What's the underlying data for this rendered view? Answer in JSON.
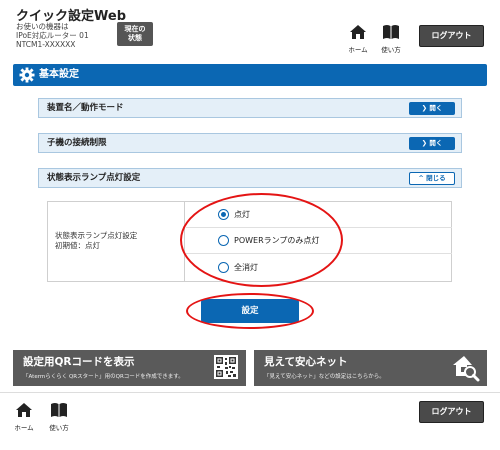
{
  "header": {
    "title": "クイック設定Web",
    "device_line1": "お使いの機器は",
    "device_line2": "IPoE対応ルーター 01",
    "device_line3": "NTCM1-XXXXXX",
    "status_button_line1": "現在の",
    "status_button_line2": "状態",
    "home_label": "ホーム",
    "help_label": "使い方",
    "logout_label": "ログアウト"
  },
  "section": {
    "title": "基本設定",
    "icon": "gear-icon"
  },
  "accordions": [
    {
      "label": "装置名／動作モード",
      "button": "開く",
      "state": "closed"
    },
    {
      "label": "子機の接続制限",
      "button": "開く",
      "state": "closed"
    },
    {
      "label": "状態表示ランプ点灯設定",
      "button": "閉じる",
      "state": "open"
    }
  ],
  "lamp_setting": {
    "label_line1": "状態表示ランプ点灯設定",
    "label_line2": "初期値：点灯",
    "options": [
      "点灯",
      "POWERランプのみ点灯",
      "全消灯"
    ],
    "selected": "点灯"
  },
  "apply_label": "設定",
  "banners": {
    "qr": {
      "title": "設定用QRコードを表示",
      "desc": "「Atermらくらく QRスタート」用のQRコードを作成できます。"
    },
    "safe": {
      "title": "見えて安心ネット",
      "desc": "「見えて安心ネット」などの設定はこちらから。"
    }
  },
  "footer": {
    "home_label": "ホーム",
    "help_label": "使い方",
    "logout_label": "ログアウト"
  },
  "colors": {
    "primary": "#0b67b3",
    "highlight": "#e41414",
    "banner": "#5a5a5a"
  }
}
